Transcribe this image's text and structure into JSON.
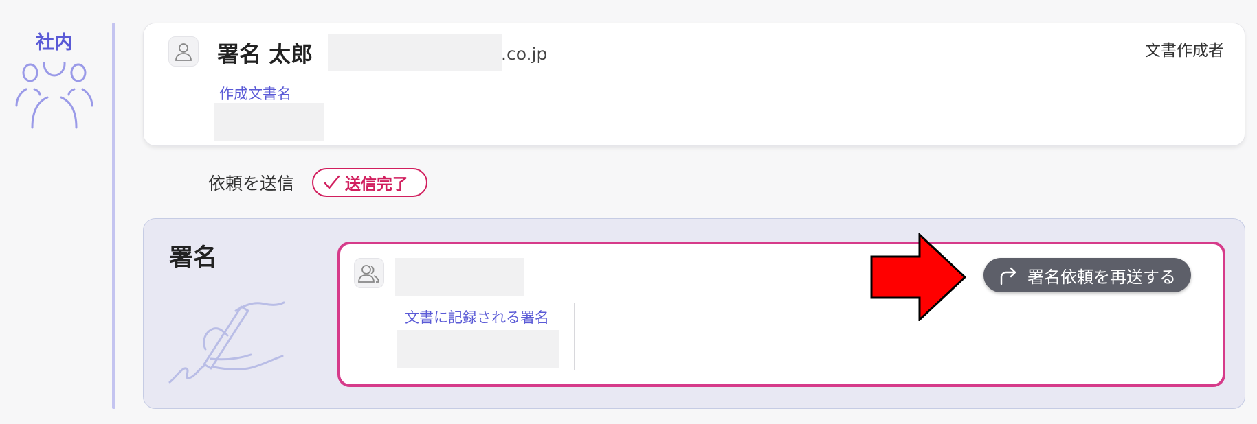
{
  "sidebar": {
    "label": "社内",
    "icon": "group-icon"
  },
  "creator": {
    "name": "署名 太郎",
    "email_suffix": ".co.jp",
    "role": "文書作成者",
    "doc_name_label": "作成文書名",
    "avatar_icon": "user-icon"
  },
  "status": {
    "text": "依頼を送信",
    "badge": "送信完了",
    "badge_icon": "check-icon"
  },
  "signature": {
    "title": "署名",
    "icon": "pen-signature-icon",
    "recorded_label": "文書に記録される署名",
    "avatar_icon": "users-icon",
    "resend_label": "署名依頼を再送する",
    "resend_icon": "forward-arrow-icon"
  },
  "colors": {
    "accent": "#5a5ad6",
    "badge": "#d11f5e",
    "signer_border": "#d63b8a",
    "button_bg": "#5d5f69",
    "annotation_arrow": "#ff0000"
  }
}
